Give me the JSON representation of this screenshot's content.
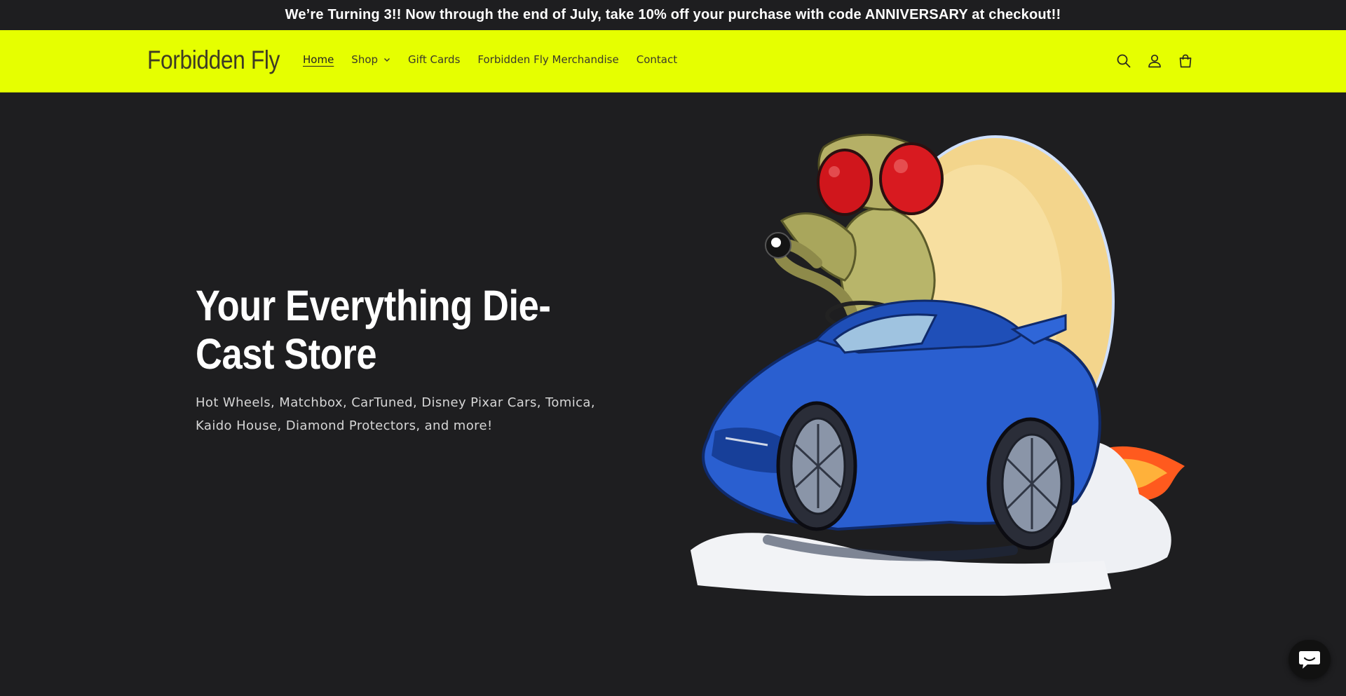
{
  "announcement": {
    "text": "We’re Turning 3!! Now through the end of July, take 10% off your purchase with code ANNIVERSARY at checkout!!"
  },
  "header": {
    "logo": "Forbidden Fly",
    "nav": [
      {
        "label": "Home",
        "active": true
      },
      {
        "label": "Shop",
        "has_dropdown": true
      },
      {
        "label": "Gift Cards"
      },
      {
        "label": "Forbidden Fly Merchandise"
      },
      {
        "label": "Contact"
      }
    ],
    "icons": [
      "search-icon",
      "account-icon",
      "cart-icon"
    ],
    "background": "#e6ff00"
  },
  "hero": {
    "title": "Your Everything Die-Cast Store",
    "subtitle": "Hot Wheels, Matchbox, CarTuned, Disney Pixar Cars, Tomica, Kaido House, Diamond Protectors, and more!"
  },
  "chat": {
    "icon": "chat-bubble-icon"
  },
  "colors": {
    "page_background": "#1e1e20",
    "accent": "#e6ff00",
    "car_blue": "#2a5fd0"
  }
}
